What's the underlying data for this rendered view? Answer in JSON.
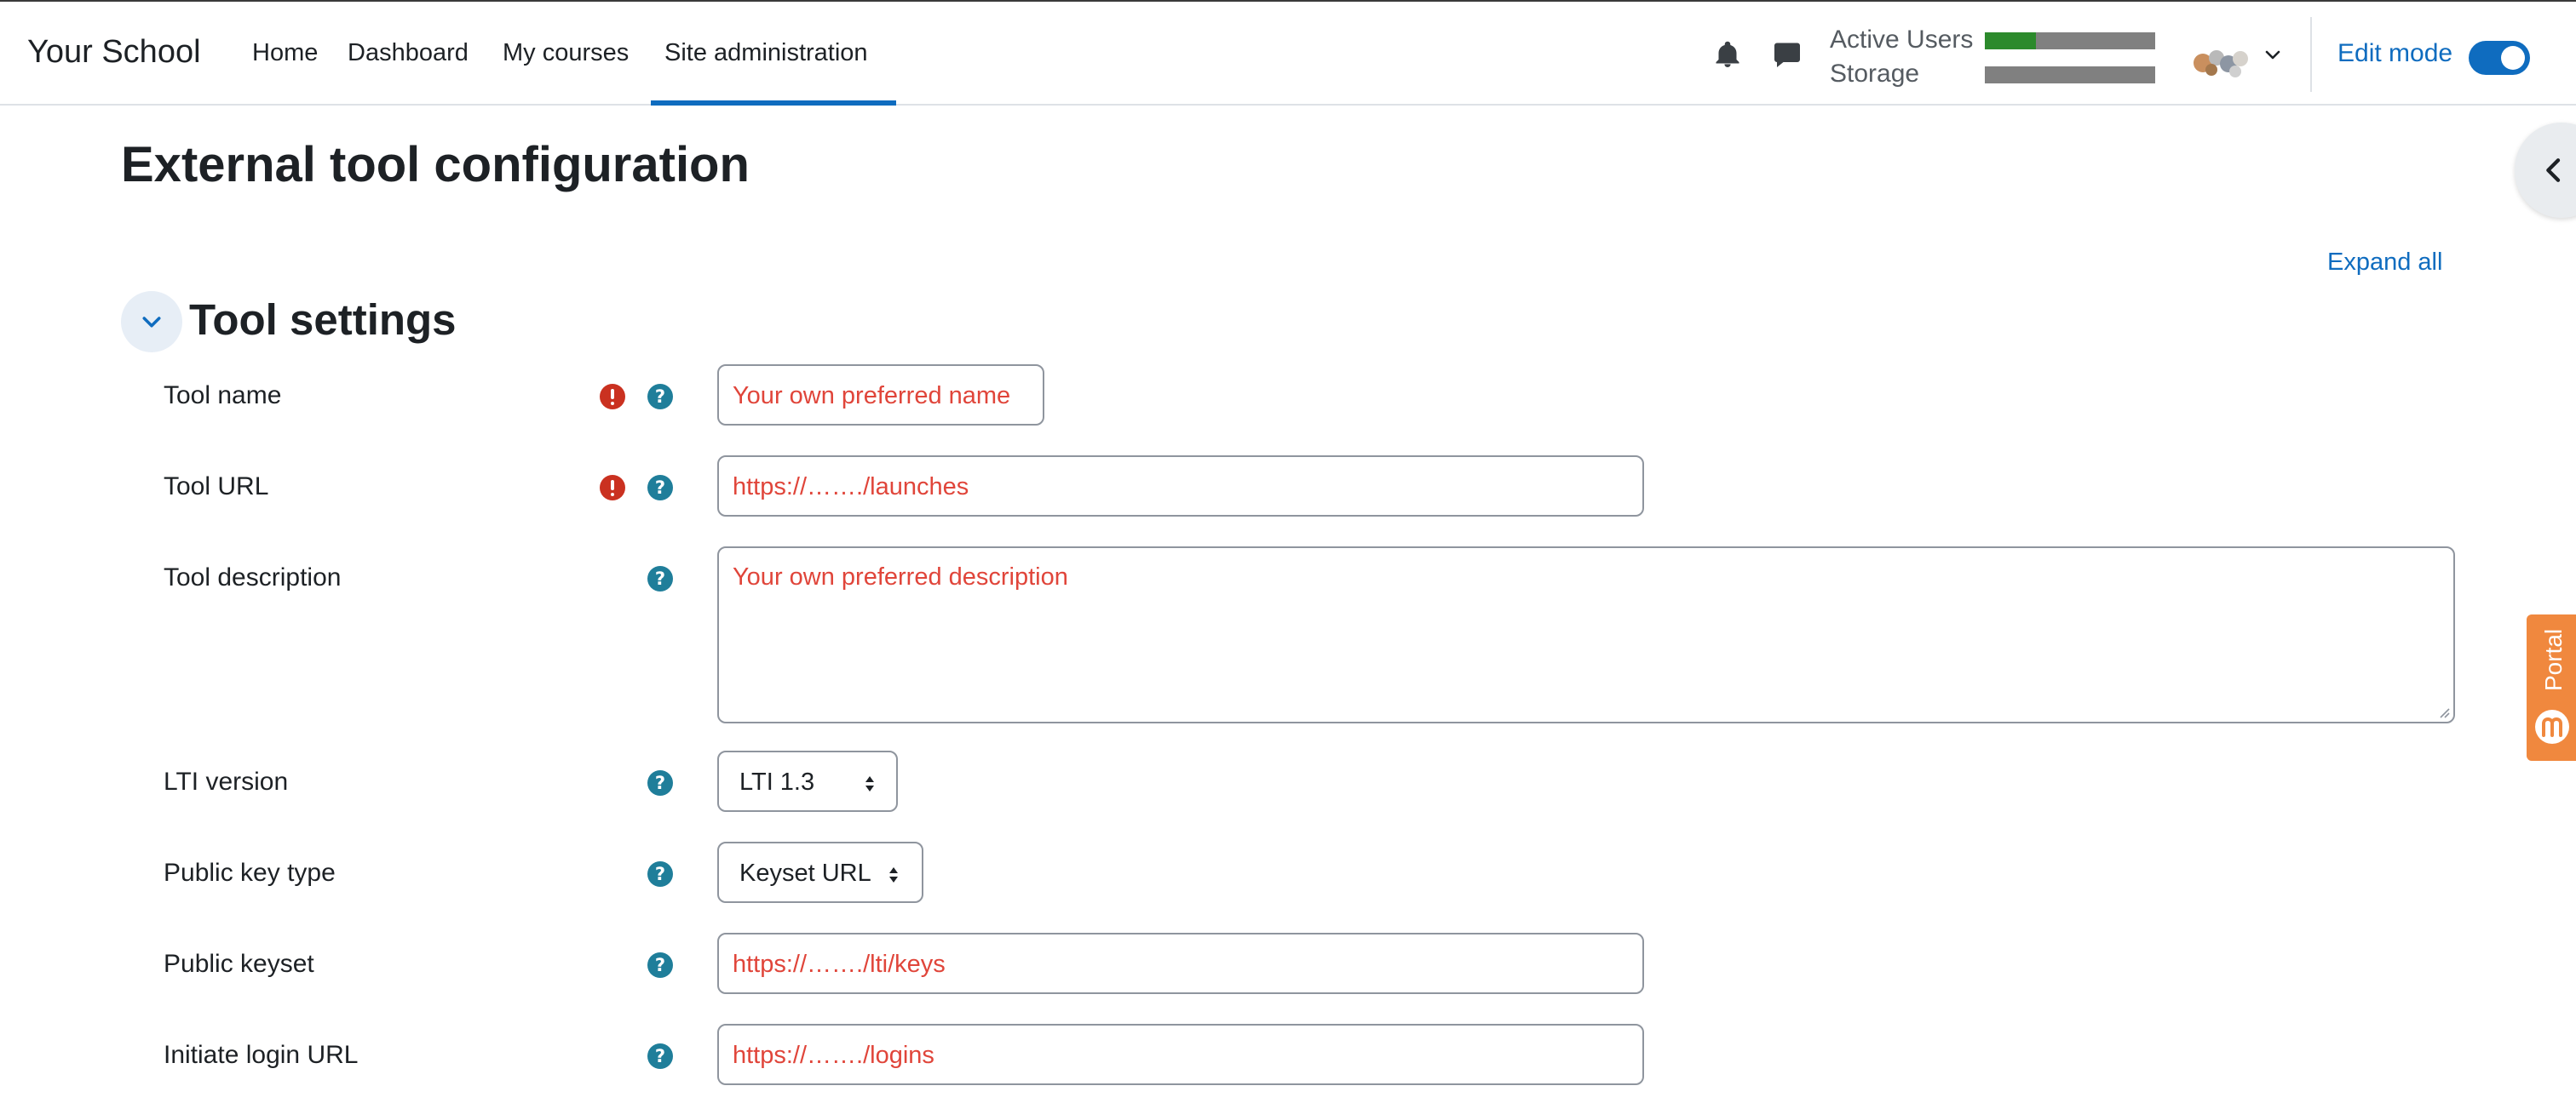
{
  "navbar": {
    "brand": "Your School",
    "links": [
      "Home",
      "Dashboard",
      "My courses",
      "Site administration"
    ],
    "active_link": "Site administration",
    "usage": {
      "active_users_label": "Active Users",
      "active_users_fill": 0.3,
      "storage_label": "Storage",
      "storage_fill": 0.0
    },
    "edit_mode_label": "Edit mode",
    "edit_mode_on": true
  },
  "page": {
    "title": "External tool configuration",
    "expand_all": "Expand all"
  },
  "section": {
    "title": "Tool settings",
    "fields": {
      "tool_name": {
        "label": "Tool name",
        "value": "Your own preferred name"
      },
      "tool_url": {
        "label": "Tool URL",
        "value": "https://……./launches"
      },
      "tool_description": {
        "label": "Tool description",
        "value": "Your own preferred description"
      },
      "lti_version": {
        "label": "LTI version",
        "value": "LTI 1.3"
      },
      "public_key_type": {
        "label": "Public key type",
        "value": "Keyset URL"
      },
      "public_keyset": {
        "label": "Public keyset",
        "value": "https://……./lti/keys"
      },
      "initiate_login_url": {
        "label": "Initiate login URL",
        "value": "https://……./logins"
      }
    }
  },
  "side_tab": {
    "label": "Portal"
  },
  "colors": {
    "accent": "#0f6cbf",
    "required": "#ca3120",
    "help": "#1f7e9a",
    "field_text": "#e0453a",
    "usage_fill": "#2c8a2c",
    "portal": "#f0883e"
  },
  "icons": {
    "notifications": "bell-icon",
    "messages": "chat-icon",
    "user_menu": "chevron-down-icon",
    "drawer": "chevron-left-icon",
    "section": "chevron-down-icon",
    "required": "exclamation-circle-icon",
    "help": "question-circle-icon"
  }
}
